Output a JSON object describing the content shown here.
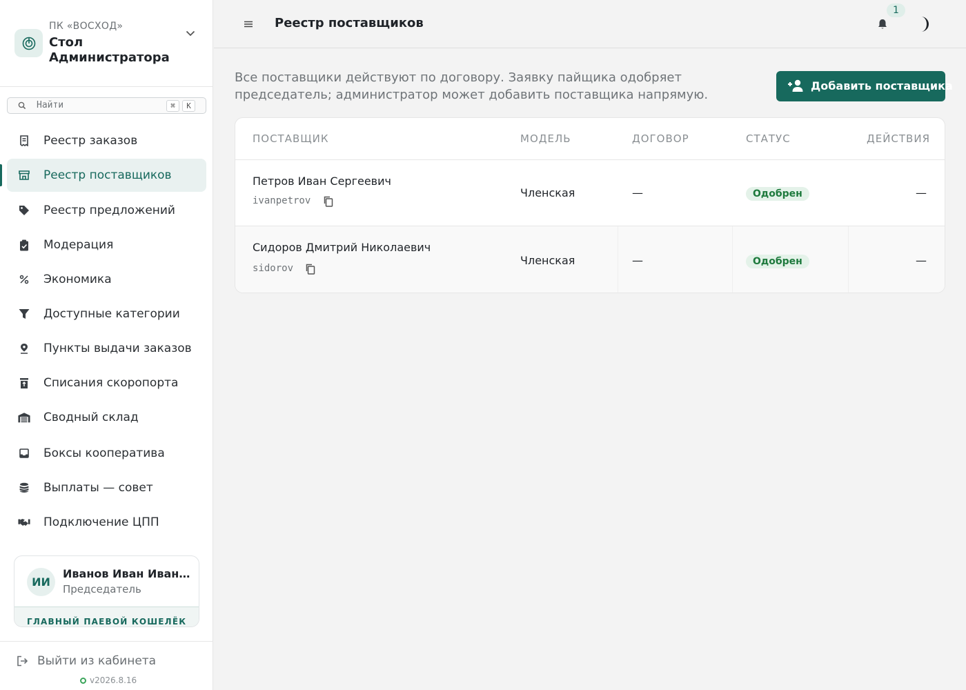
{
  "sidebar": {
    "org_sub": "ПК «ВОСХОД»",
    "org_title": "Стол Администратора",
    "search_placeholder": "Найти",
    "kbd_cmd": "⌘",
    "kbd_key": "K",
    "items": [
      {
        "label": "Реестр заказов",
        "icon": "receipt-icon"
      },
      {
        "label": "Реестр поставщиков",
        "icon": "store-icon",
        "active": true
      },
      {
        "label": "Реестр предложений",
        "icon": "tag-icon"
      },
      {
        "label": "Модерация",
        "icon": "clipboard-check-icon"
      },
      {
        "label": "Экономика",
        "icon": "percent-icon"
      },
      {
        "label": "Доступные категории",
        "icon": "filter-icon"
      },
      {
        "label": "Пункты выдачи заказов",
        "icon": "map-pin-icon"
      },
      {
        "label": "Списания скоропорта",
        "icon": "trash-icon"
      },
      {
        "label": "Сводный склад",
        "icon": "warehouse-icon"
      },
      {
        "label": "Боксы кооператива",
        "icon": "inbox-icon"
      },
      {
        "label": "Выплаты — совет",
        "icon": "coins-icon"
      },
      {
        "label": "Подключение ЦПП",
        "icon": "handshake-icon"
      }
    ],
    "user": {
      "initials": "ИИ",
      "name": "Иванов Иван Иванович",
      "role": "Председатель",
      "wallet": "ГЛАВНЫЙ ПАЕВОЙ КОШЕЛЁК"
    },
    "logout": "Выйти из кабинета",
    "version": "v2026.8.16"
  },
  "header": {
    "title": "Реестр поставщиков",
    "notifications": "1"
  },
  "main": {
    "intro": "Все поставщики действуют по договору. Заявку пайщика одобряет председатель; администратор может добавить поставщика напрямую.",
    "add_button": "Добавить поставщика",
    "columns": [
      "ПОСТАВЩИК",
      "МОДЕЛЬ",
      "ДОГОВОР",
      "СТАТУС",
      "ДЕЙСТВИЯ"
    ],
    "rows": [
      {
        "name": "Петров Иван Сергеевич",
        "login": "ivanpetrov",
        "model": "Членская",
        "contract": "—",
        "status": "Одобрен",
        "actions": "—"
      },
      {
        "name": "Сидоров Дмитрий Николаевич",
        "login": "sidorov",
        "model": "Членская",
        "contract": "—",
        "status": "Одобрен",
        "actions": "—"
      }
    ]
  },
  "colors": {
    "accent": "#17695d",
    "status_green": "#1e7a3d",
    "status_bg": "#e4f2e9"
  }
}
